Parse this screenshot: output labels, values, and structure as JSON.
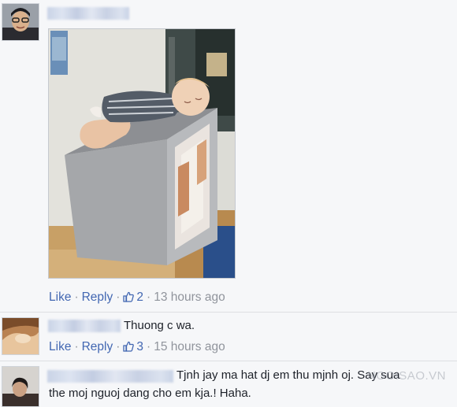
{
  "comments": [
    {
      "text": "",
      "actions": {
        "like": "Like",
        "reply": "Reply",
        "likes_count": "2",
        "time": "13 hours ago"
      }
    },
    {
      "text": "Thuong c wa.",
      "actions": {
        "like": "Like",
        "reply": "Reply",
        "likes_count": "3",
        "time": "15 hours ago"
      }
    },
    {
      "text_line1": "Tjnh jay ma hat dj em thu mjnh oj. Say sua",
      "text_line2": "the moj nguoj dang cho em kja.! Haha."
    }
  ],
  "watermark": "NGOISAO.VN",
  "colors": {
    "link": "#4267b2",
    "meta": "#90949c",
    "background": "#f6f7f9"
  }
}
